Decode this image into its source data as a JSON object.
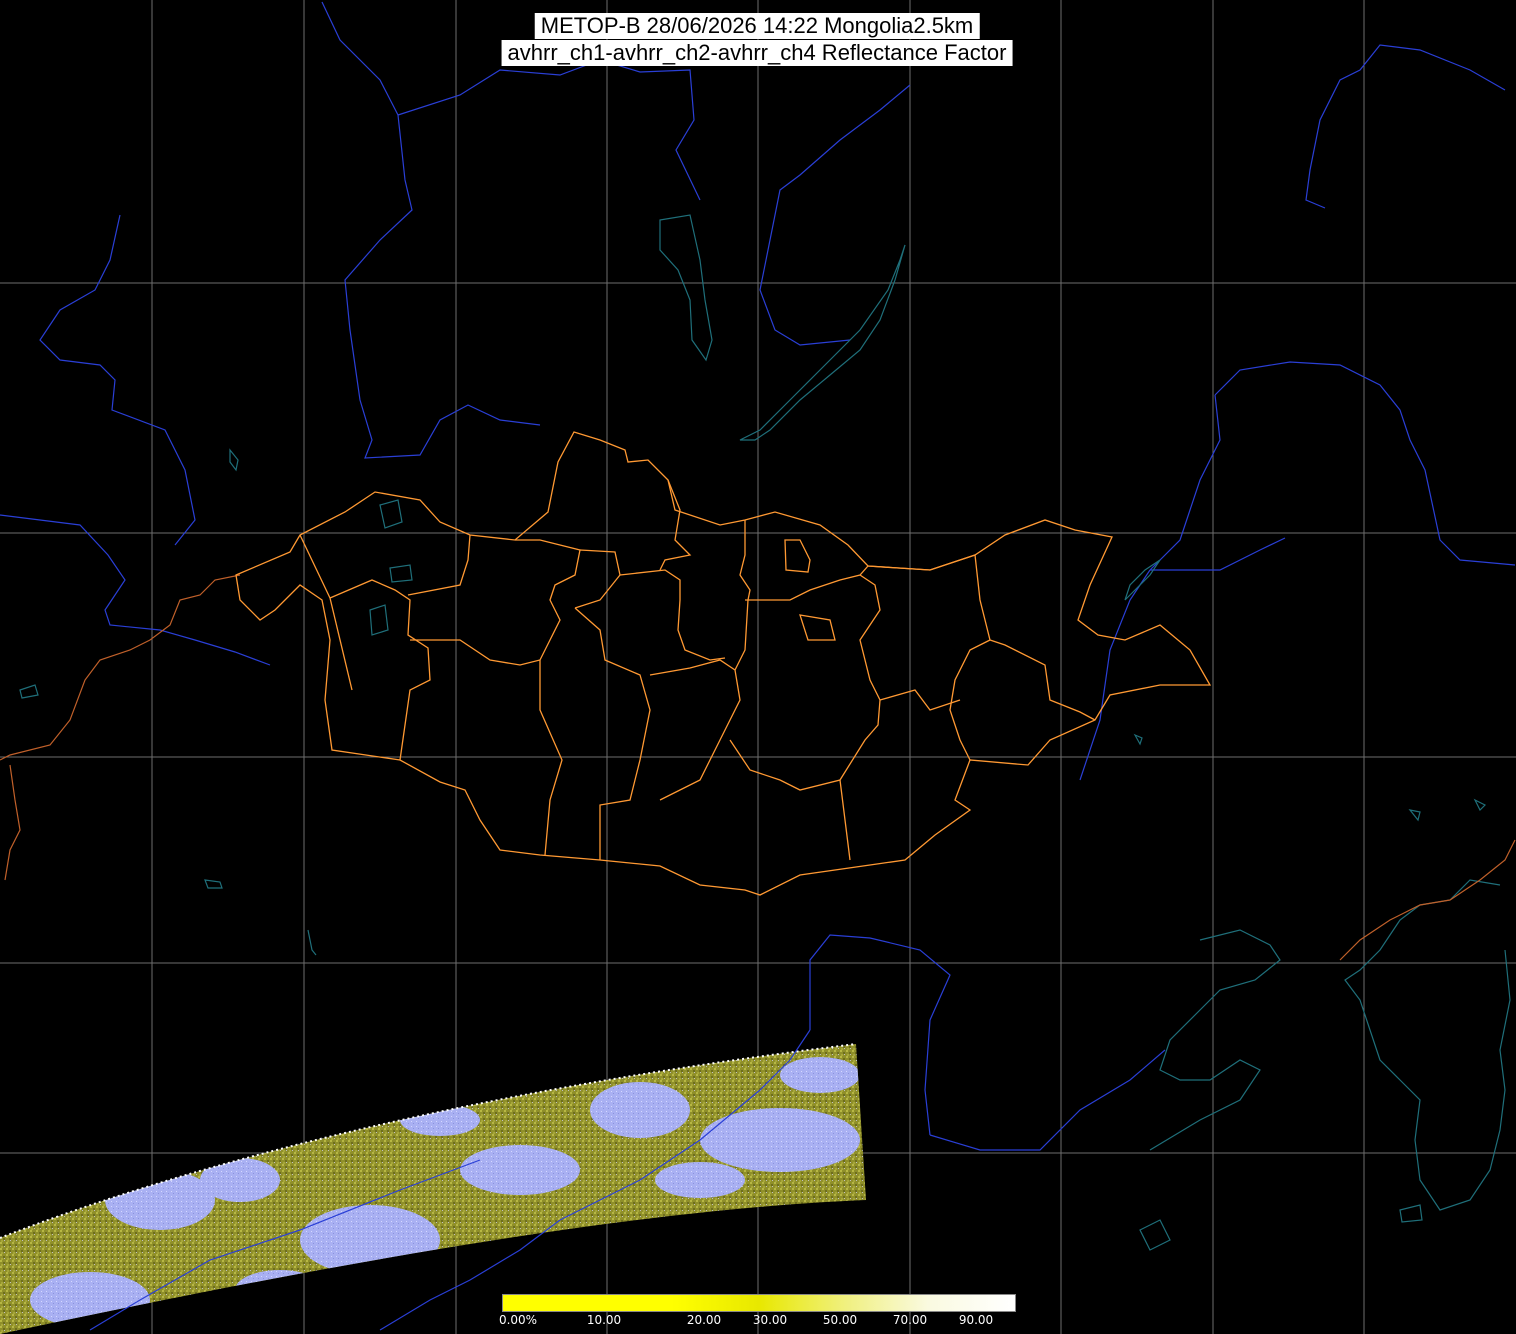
{
  "title": {
    "line1": "METOP-B 28/06/2026 14:22 Mongolia2.5km",
    "line2": "avhrr_ch1-avhrr_ch2-avhrr_ch4 Reflectance Factor"
  },
  "colorbar": {
    "labels": [
      "0.00%",
      "10.00",
      "20.00",
      "30.00",
      "50.00",
      "70.00",
      "90.00"
    ],
    "stops": [
      "#ffff00",
      "#ffff00",
      "#ffff00",
      "#e8e800",
      "#f0f080",
      "#fafae0",
      "#ffffff"
    ]
  },
  "colors": {
    "background": "#000000",
    "graticule": "#6e6e6e",
    "rivers": "#2a3fd6",
    "coastlines_lakes": "#1f6f7a",
    "mongolia_admin": "#ff9933",
    "country_borders": "#c0602a",
    "swath_vegetation": "#9a9a2e",
    "swath_cloud": "#a9b0f2"
  }
}
